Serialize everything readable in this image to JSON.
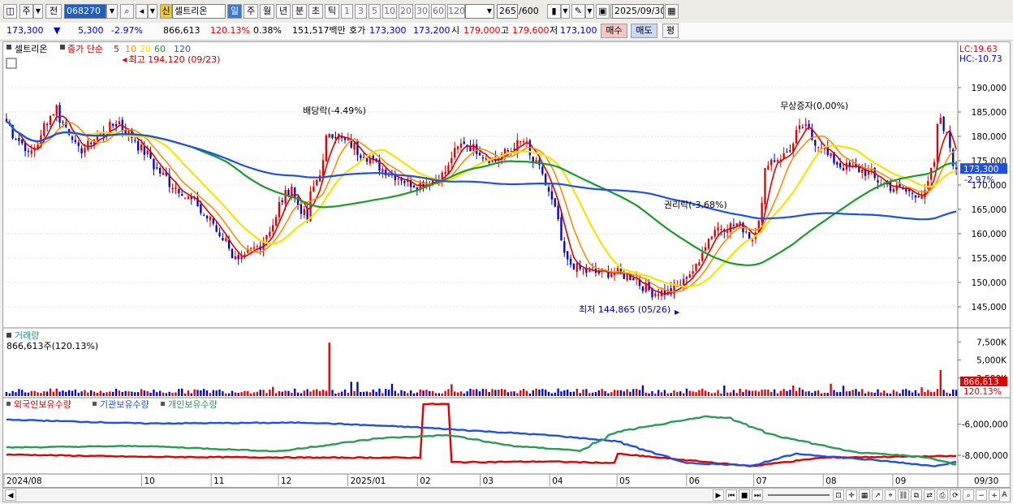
{
  "toolbar": {
    "period_short": "주",
    "prev_label": "전",
    "code": "068270",
    "badge_new": "신",
    "stock_name": "셀트리온",
    "periods": [
      "일",
      "주",
      "월",
      "년",
      "분",
      "초",
      "틱"
    ],
    "intervals": [
      "1",
      "3",
      "5",
      "10",
      "20",
      "30",
      "60",
      "120"
    ],
    "count": "265",
    "count_max": "/600",
    "date": "2025/09/30"
  },
  "quote": {
    "price": "173,300",
    "arrow": "▼",
    "change": "5,300",
    "change_pct": "-2.97%",
    "volume": "866,613",
    "volume_ratio": "120.13%",
    "turnover": "0.38%",
    "amount": "151,517백만",
    "ask_label": "호가",
    "ask": "173,300",
    "bid": "173,200",
    "open_label": "시",
    "open": "179,000",
    "high_label": "고",
    "high": "179,600",
    "low_label": "저",
    "low": "173,100",
    "buy_label": "매수",
    "sell_label": "매도",
    "eval_label": "평"
  },
  "colors": {
    "up": "#e00000",
    "down": "#0000d0",
    "ma5": "#e00000",
    "ma10": "#ff8c00",
    "ma20": "#f5e400",
    "ma60": "#1a9a2a",
    "ma120": "#2050e0",
    "foreign": "#e00000",
    "institution": "#2050e0",
    "individual": "#2a9a55"
  },
  "main_panel": {
    "title": "셀트리온",
    "legend_prefix": "종가 단순",
    "legend_periods": [
      "5",
      "10",
      "20",
      "60",
      "120"
    ],
    "high_marker": "최고 194,120 (09/23)",
    "low_marker": "최저 144,865 (05/26)",
    "event_dividend": "배당락(-4.49%)",
    "event_rights": "권리락(-3,68%)",
    "event_bonus": "무상증자(0,00%)",
    "lc_label": "LC:19.63",
    "hc_label": "HC:-10.73",
    "last_price_tag": "173,300",
    "last_pct_tag": "-2.97%"
  },
  "volume_panel": {
    "title": "거래량",
    "value_label": "866,613주(120.13%)",
    "last_tag": "866,613",
    "last_pct": "120.13%"
  },
  "holding_panel": {
    "legend": [
      "외국인보유수량",
      "기관보유수량",
      "개인보유수량"
    ]
  },
  "x_axis": {
    "labels": [
      "2024/08",
      "10",
      "11",
      "12",
      "2025/01",
      "02",
      "03",
      "04",
      "05",
      "06",
      "07",
      "08",
      "09"
    ],
    "right_label": "09/30"
  },
  "chart_data": [
    {
      "type": "candlestick",
      "title": "셀트리온",
      "ylim": [
        141000,
        197000
      ],
      "yticks": [
        145000,
        150000,
        155000,
        160000,
        165000,
        170000,
        175000,
        180000,
        185000,
        190000
      ],
      "ytick_labels": [
        "145,000",
        "150,000",
        "155,000",
        "160,000",
        "165,000",
        "170,000",
        "175,000",
        "180,000",
        "185,000",
        "190,000"
      ],
      "anchor_closes": [
        [
          "2024-08-01",
          183000
        ],
        [
          "2024-08-12",
          176000
        ],
        [
          "2024-08-23",
          186000
        ],
        [
          "2024-09-03",
          177000
        ],
        [
          "2024-09-20",
          183000
        ],
        [
          "2024-09-30",
          178000
        ],
        [
          "2024-10-10",
          172000
        ],
        [
          "2024-10-25",
          166000
        ],
        [
          "2024-11-05",
          160000
        ],
        [
          "2024-11-13",
          154000
        ],
        [
          "2024-11-25",
          159000
        ],
        [
          "2024-12-06",
          170000
        ],
        [
          "2024-12-13",
          163000
        ],
        [
          "2024-12-24",
          181000
        ],
        [
          "2025-01-03",
          178000
        ],
        [
          "2025-01-17",
          173000
        ],
        [
          "2025-01-31",
          170000
        ],
        [
          "2025-02-12",
          172000
        ],
        [
          "2025-02-21",
          179000
        ],
        [
          "2025-03-07",
          175000
        ],
        [
          "2025-03-20",
          179000
        ],
        [
          "2025-03-31",
          170000
        ],
        [
          "2025-04-09",
          154000
        ],
        [
          "2025-04-18",
          152000
        ],
        [
          "2025-04-30",
          152000
        ],
        [
          "2025-05-09",
          151000
        ],
        [
          "2025-05-16",
          148000
        ],
        [
          "2025-05-26",
          148000
        ],
        [
          "2025-06-05",
          153000
        ],
        [
          "2025-06-13",
          161000
        ],
        [
          "2025-06-24",
          162000
        ],
        [
          "2025-07-01",
          159000
        ],
        [
          "2025-07-08",
          175000
        ],
        [
          "2025-07-15",
          176000
        ],
        [
          "2025-07-23",
          182000
        ],
        [
          "2025-07-31",
          178000
        ],
        [
          "2025-08-08",
          174000
        ],
        [
          "2025-08-19",
          173000
        ],
        [
          "2025-08-29",
          170000
        ],
        [
          "2025-09-09",
          168500
        ],
        [
          "2025-09-16",
          168000
        ],
        [
          "2025-09-23",
          184000
        ],
        [
          "2025-09-26",
          178000
        ],
        [
          "2025-09-30",
          173300
        ]
      ],
      "moving_averages": [
        "5",
        "10",
        "20",
        "60",
        "120"
      ]
    },
    {
      "type": "bar",
      "title": "거래량",
      "ylim": [
        0,
        9000000
      ],
      "yticks": [
        2500000,
        5000000,
        7500000
      ],
      "ytick_labels": [
        "2,500K",
        "5,000K",
        "7,500K"
      ],
      "typical_volume": 700000,
      "spikes": [
        [
          "2024-12-24",
          7400000
        ],
        [
          "2025-09-23",
          3600000
        ],
        [
          "2025-09-30",
          866613
        ]
      ]
    },
    {
      "type": "line",
      "title": "보유수량",
      "ylim": [
        -9100000,
        -4500000
      ],
      "yticks": [
        -6000000,
        -8000000
      ],
      "ytick_labels": [
        "-6,000,000",
        "-8,000,000"
      ],
      "series": [
        {
          "name": "외국인보유수량",
          "anchors": [
            [
              "2024-08-01",
              -7950000
            ],
            [
              "2024-10-01",
              -8100000
            ],
            [
              "2024-12-20",
              -8150000
            ],
            [
              "2025-02-03",
              -8150000
            ],
            [
              "2025-02-04",
              -4700000
            ],
            [
              "2025-02-14",
              -4700000
            ],
            [
              "2025-02-15",
              -8450000
            ],
            [
              "2025-03-31",
              -8400000
            ],
            [
              "2025-04-30",
              -8500000
            ],
            [
              "2025-05-01",
              -7900000
            ],
            [
              "2025-06-30",
              -8700000
            ],
            [
              "2025-08-01",
              -8150000
            ],
            [
              "2025-09-30",
              -8050000
            ]
          ]
        },
        {
          "name": "기관보유수량",
          "anchors": [
            [
              "2024-08-01",
              -5700000
            ],
            [
              "2024-10-01",
              -5950000
            ],
            [
              "2024-12-15",
              -5900000
            ],
            [
              "2025-02-01",
              -6200000
            ],
            [
              "2025-03-31",
              -6700000
            ],
            [
              "2025-05-01",
              -7100000
            ],
            [
              "2025-06-01",
              -8500000
            ],
            [
              "2025-07-01",
              -8650000
            ],
            [
              "2025-07-20",
              -7900000
            ],
            [
              "2025-08-31",
              -8400000
            ],
            [
              "2025-09-20",
              -8700000
            ],
            [
              "2025-09-30",
              -8400000
            ]
          ]
        },
        {
          "name": "개인보유수량",
          "anchors": [
            [
              "2024-08-01",
              -7500000
            ],
            [
              "2024-10-01",
              -7400000
            ],
            [
              "2024-12-01",
              -7750000
            ],
            [
              "2025-01-15",
              -6900000
            ],
            [
              "2025-02-15",
              -6700000
            ],
            [
              "2025-03-15",
              -7400000
            ],
            [
              "2025-04-15",
              -7700000
            ],
            [
              "2025-05-01",
              -6500000
            ],
            [
              "2025-06-10",
              -5500000
            ],
            [
              "2025-06-20",
              -5600000
            ],
            [
              "2025-07-10",
              -6700000
            ],
            [
              "2025-08-15",
              -7800000
            ],
            [
              "2025-09-15",
              -8100000
            ],
            [
              "2025-09-30",
              -8600000
            ]
          ]
        }
      ]
    }
  ]
}
